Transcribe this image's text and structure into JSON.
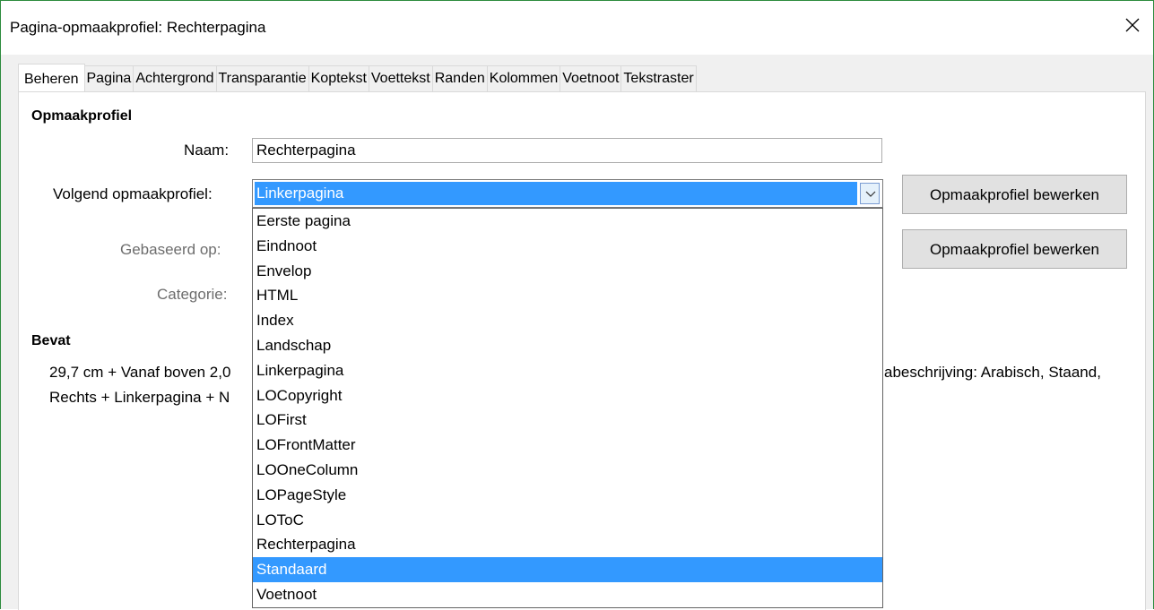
{
  "window": {
    "title": "Pagina-opmaakprofiel: Rechterpagina",
    "close_icon": "close-icon"
  },
  "tabs": [
    {
      "label": "Beheren",
      "active": true
    },
    {
      "label": "Pagina"
    },
    {
      "label": "Achtergrond"
    },
    {
      "label": "Transparantie"
    },
    {
      "label": "Koptekst"
    },
    {
      "label": "Voettekst"
    },
    {
      "label": "Randen"
    },
    {
      "label": "Kolommen"
    },
    {
      "label": "Voetnoot"
    },
    {
      "label": "Tekstraster"
    }
  ],
  "style_section": {
    "heading": "Opmaakprofiel",
    "name_label": "Naam:",
    "name_value": "Rechterpagina",
    "next_style_label": "Volgend opmaakprofiel:",
    "next_style_value": "Linkerpagina",
    "based_on_label": "Gebaseerd op:",
    "category_label": "Categorie:",
    "edit_button_1": "Opmaakprofiel bewerken",
    "edit_button_2": "Opmaakprofiel bewerken"
  },
  "dropdown_options": [
    "Eerste pagina",
    "Eindnoot",
    "Envelop",
    "HTML",
    "Index",
    "Landschap",
    "Linkerpagina",
    "LOCopyright",
    "LOFirst",
    "LOFrontMatter",
    "LOOneColumn",
    "LOPageStyle",
    "LOToC",
    "Rechterpagina",
    "Standaard",
    "Voetnoot"
  ],
  "highlighted_option": "Standaard",
  "contains_section": {
    "heading": "Bevat",
    "line1_left": "29,7 cm + Vanaf boven 2,0",
    "line1_right": "abeschrijving: Arabisch, Staand,",
    "line2_left": "Rechts + Linkerpagina + N"
  },
  "colors": {
    "selection": "#3399ff",
    "window_border": "#2d8b3e"
  }
}
